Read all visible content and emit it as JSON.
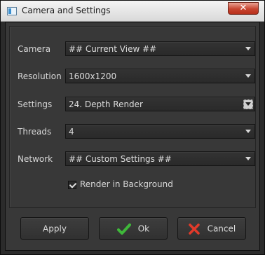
{
  "window": {
    "title": "Camera and Settings",
    "close_glyph": "✕"
  },
  "form": {
    "camera": {
      "label": "Camera",
      "value": "## Current View ##"
    },
    "resolution": {
      "label": "Resolution",
      "value": "1600x1200"
    },
    "settings": {
      "label": "Settings",
      "value": "24. Depth Render"
    },
    "threads": {
      "label": "Threads",
      "value": "4"
    },
    "network": {
      "label": "Network",
      "value": "## Custom Settings ##"
    },
    "background": {
      "label": "Render in Background",
      "checked": true
    }
  },
  "buttons": {
    "apply": "Apply",
    "ok": {
      "label": "Ok",
      "icon": "check-icon",
      "color": "#3fb83a"
    },
    "cancel": {
      "label": "Cancel",
      "icon": "cross-icon",
      "color": "#e23a2a"
    }
  }
}
